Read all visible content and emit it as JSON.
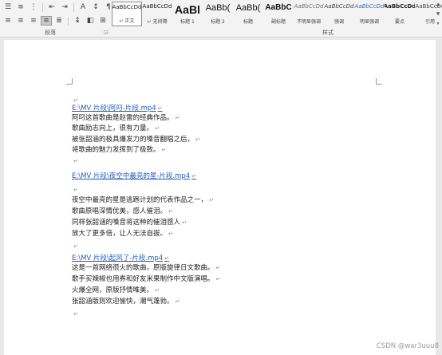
{
  "ribbon": {
    "paragraph_group_label": "段落",
    "styles_group_label": "样式",
    "styles": [
      {
        "preview": "AaBbCcDd",
        "name": "↵ 正文",
        "size": "7px",
        "weight": "normal",
        "color": "#222",
        "italic": false
      },
      {
        "preview": "AaBbCcDd",
        "name": "↵ 无间隔",
        "size": "7px",
        "weight": "normal",
        "color": "#222",
        "italic": false
      },
      {
        "preview": "AaBl",
        "name": "标题 1",
        "size": "14px",
        "weight": "bold",
        "color": "#111",
        "italic": false
      },
      {
        "preview": "AaBb(",
        "name": "标题 2",
        "size": "11px",
        "weight": "normal",
        "color": "#111",
        "italic": false
      },
      {
        "preview": "AaBb(",
        "name": "标题",
        "size": "11px",
        "weight": "normal",
        "color": "#111",
        "italic": false
      },
      {
        "preview": "AaBbC",
        "name": "副标题",
        "size": "10px",
        "weight": "bold",
        "color": "#111",
        "italic": false
      },
      {
        "preview": "AaBbCcDd",
        "name": "不明显强调",
        "size": "7px",
        "weight": "normal",
        "color": "#777",
        "italic": true
      },
      {
        "preview": "AaBbCcDd",
        "name": "强调",
        "size": "7px",
        "weight": "normal",
        "color": "#444",
        "italic": true
      },
      {
        "preview": "AaBbCcDd",
        "name": "明显强调",
        "size": "7px",
        "weight": "normal",
        "color": "#3a6fc4",
        "italic": true
      },
      {
        "preview": "AaBbCcDd",
        "name": "要点",
        "size": "7px",
        "weight": "bold",
        "color": "#222",
        "italic": false
      },
      {
        "preview": "AaBbCcDd",
        "name": "引用",
        "size": "7px",
        "weight": "normal",
        "color": "#444",
        "italic": false
      }
    ]
  },
  "document": {
    "lines": [
      {
        "text": "",
        "link": false
      },
      {
        "text": "E:\\MV 片段\\阿叼-片段.mp4",
        "link": true
      },
      {
        "text": "阿叼这首歌曲是赵雷的经典作品。",
        "link": false
      },
      {
        "text": "歌曲励志向上，很有力量。",
        "link": false
      },
      {
        "text": "被张韶涵的极具爆发力的嗓音翻唱之后，",
        "link": false
      },
      {
        "text": "将歌曲的魅力发挥到了极致。",
        "link": false
      },
      {
        "text": "",
        "link": false
      },
      {
        "text": "E:\\MV 片段\\夜空中最亮的星-片段.mp4",
        "link": true
      },
      {
        "text": "",
        "link": false
      },
      {
        "text": "夜空中最亮的星是逃跑计划的代表作品之一，",
        "link": false
      },
      {
        "text": "歌曲原唱深情优美，感人催泪。",
        "link": false
      },
      {
        "text": "同样张韶涵的嗓音将这种的催泪感人",
        "link": false
      },
      {
        "text": "放大了更多倍，让人无法自拔。",
        "link": false
      },
      {
        "text": "",
        "link": false
      },
      {
        "text": "E:\\MV 片段\\起风了-片段.mp4",
        "link": true
      },
      {
        "text": "这是一首网络很火的歌曲，原版旋律日文歌曲。",
        "link": false
      },
      {
        "text": "歌手买辣椒也用券和好友米果制作中文版演唱。",
        "link": false
      },
      {
        "text": "火爆全网，原版抒情唯美。",
        "link": false
      },
      {
        "text": "张韶涵版则欢迎愉快，潮气蓬勃。",
        "link": false
      },
      {
        "text": "",
        "link": false
      }
    ]
  },
  "watermark": "CSDN @war3uuu8"
}
